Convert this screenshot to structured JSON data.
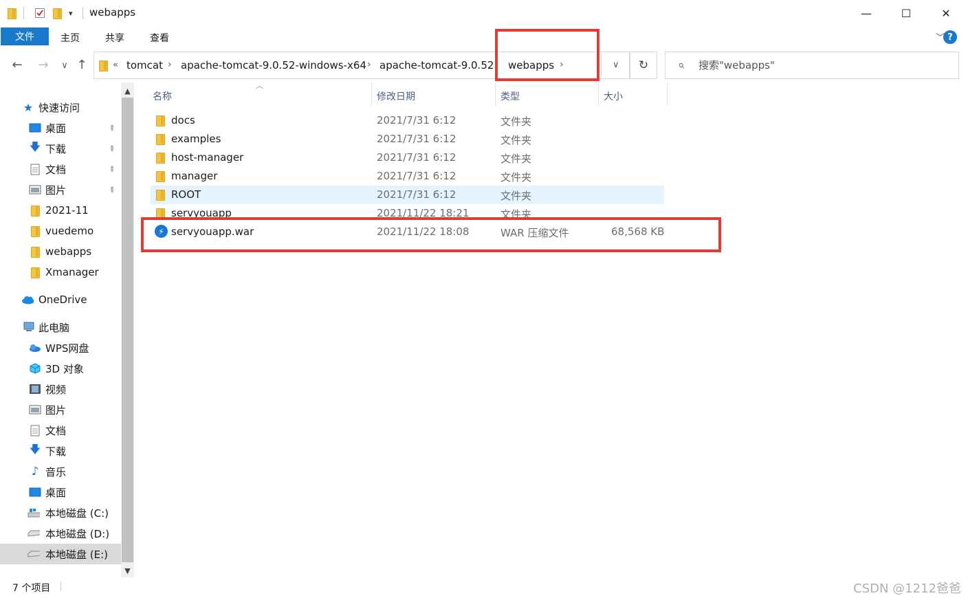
{
  "window": {
    "title": "webapps",
    "minimize": "—",
    "maximize": "☐",
    "close": "✕"
  },
  "ribbon": {
    "file_tab": "文件",
    "tabs": [
      "主页",
      "共享",
      "查看"
    ],
    "expand": "﹀",
    "help": "?"
  },
  "address": {
    "back": "←",
    "forward": "→",
    "recent": "∨",
    "up": "↑",
    "overflow": "«",
    "crumbs": [
      "tomcat",
      "apache-tomcat-9.0.52-windows-x64",
      "apache-tomcat-9.0.52",
      "webapps"
    ],
    "separator": "›",
    "dropdown": "∨",
    "refresh": "↻"
  },
  "search": {
    "placeholder": "搜索\"webapps\"",
    "icon": "⌕"
  },
  "columns": {
    "name": "名称",
    "date": "修改日期",
    "type": "类型",
    "size": "大小"
  },
  "files": [
    {
      "name": "docs",
      "date": "2021/7/31 6:12",
      "type": "文件夹",
      "size": "",
      "kind": "folder"
    },
    {
      "name": "examples",
      "date": "2021/7/31 6:12",
      "type": "文件夹",
      "size": "",
      "kind": "folder"
    },
    {
      "name": "host-manager",
      "date": "2021/7/31 6:12",
      "type": "文件夹",
      "size": "",
      "kind": "folder"
    },
    {
      "name": "manager",
      "date": "2021/7/31 6:12",
      "type": "文件夹",
      "size": "",
      "kind": "folder"
    },
    {
      "name": "ROOT",
      "date": "2021/7/31 6:12",
      "type": "文件夹",
      "size": "",
      "kind": "folder"
    },
    {
      "name": "servyouapp",
      "date": "2021/11/22 18:21",
      "type": "文件夹",
      "size": "",
      "kind": "folder"
    },
    {
      "name": "servyouapp.war",
      "date": "2021/11/22 18:08",
      "type": "WAR 压缩文件",
      "size": "68,568 KB",
      "kind": "war"
    }
  ],
  "nav": {
    "quick_access": "快速访问",
    "quick_items": [
      "桌面",
      "下载",
      "文档",
      "图片",
      "2021-11",
      "vuedemo",
      "webapps",
      "Xmanager"
    ],
    "onedrive": "OneDrive",
    "this_pc": "此电脑",
    "pc_items": [
      "WPS网盘",
      "3D 对象",
      "视频",
      "图片",
      "文档",
      "下载",
      "音乐",
      "桌面",
      "本地磁盘 (C:)",
      "本地磁盘 (D:)",
      "本地磁盘 (E:)"
    ]
  },
  "status": {
    "count": "7 个项目"
  },
  "watermark": "CSDN @1212爸爸",
  "colors": {
    "accent": "#1979ca",
    "highlight": "#e53935",
    "hover_row": "#e5f3ff"
  }
}
